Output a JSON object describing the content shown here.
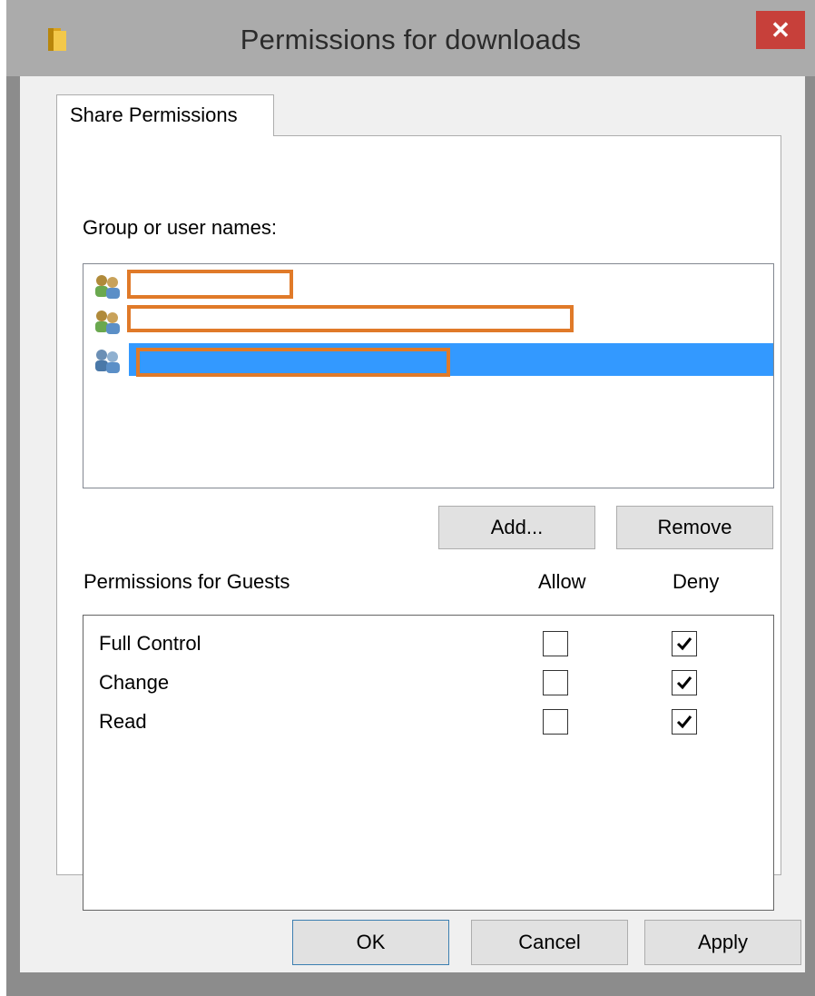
{
  "window": {
    "title": "Permissions for downloads",
    "close_label": "✕"
  },
  "tabs": [
    {
      "label": "Share Permissions",
      "active": true
    }
  ],
  "group_section": {
    "label": "Group or user names:",
    "users": [
      {
        "icon": "users-group-icon",
        "name": "",
        "selected": false
      },
      {
        "icon": "users-group-icon",
        "name": "",
        "selected": false
      },
      {
        "icon": "user-group-blue-icon",
        "name": "",
        "selected": true
      }
    ],
    "add_label": "Add...",
    "remove_label": "Remove"
  },
  "permissions": {
    "header": "Permissions for Guests",
    "allow_header": "Allow",
    "deny_header": "Deny",
    "rows": [
      {
        "name": "Full Control",
        "allow": false,
        "deny": true
      },
      {
        "name": "Change",
        "allow": false,
        "deny": true
      },
      {
        "name": "Read",
        "allow": false,
        "deny": true
      }
    ]
  },
  "footer": {
    "ok_label": "OK",
    "cancel_label": "Cancel",
    "apply_label": "Apply"
  },
  "colors": {
    "titlebar": "#ababab",
    "close": "#c7403a",
    "selection": "#3399ff",
    "redaction_outline": "#e07a29"
  }
}
